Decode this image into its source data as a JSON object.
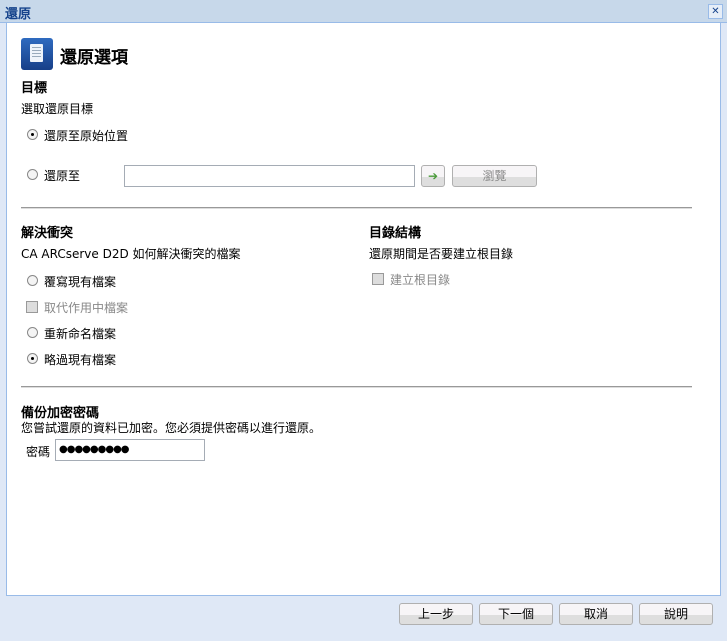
{
  "window": {
    "title": "還原"
  },
  "header": {
    "title": "還原選項"
  },
  "destination": {
    "heading": "目標",
    "subheading": "選取還原目標",
    "option_original": "還原至原始位置",
    "option_to": "還原至",
    "path_value": "",
    "browse_label": "瀏覽"
  },
  "conflict": {
    "heading": "解決衝突",
    "description": "CA ARCserve D2D 如何解決衝突的檔案",
    "options": [
      "覆寫現有檔案",
      "取代作用中檔案",
      "重新命名檔案",
      "略過現有檔案"
    ]
  },
  "directory": {
    "heading": "目錄結構",
    "description": "還原期間是否要建立根目錄",
    "create_root": "建立根目錄"
  },
  "encryption": {
    "heading": "備份加密密碼",
    "description": "您嘗試還原的資料已加密。您必須提供密碼以進行還原。",
    "password_label": "密碼",
    "password_value": "●●●●●●●●●"
  },
  "footer": {
    "back": "上一步",
    "next": "下一個",
    "cancel": "取消",
    "help": "說明"
  }
}
